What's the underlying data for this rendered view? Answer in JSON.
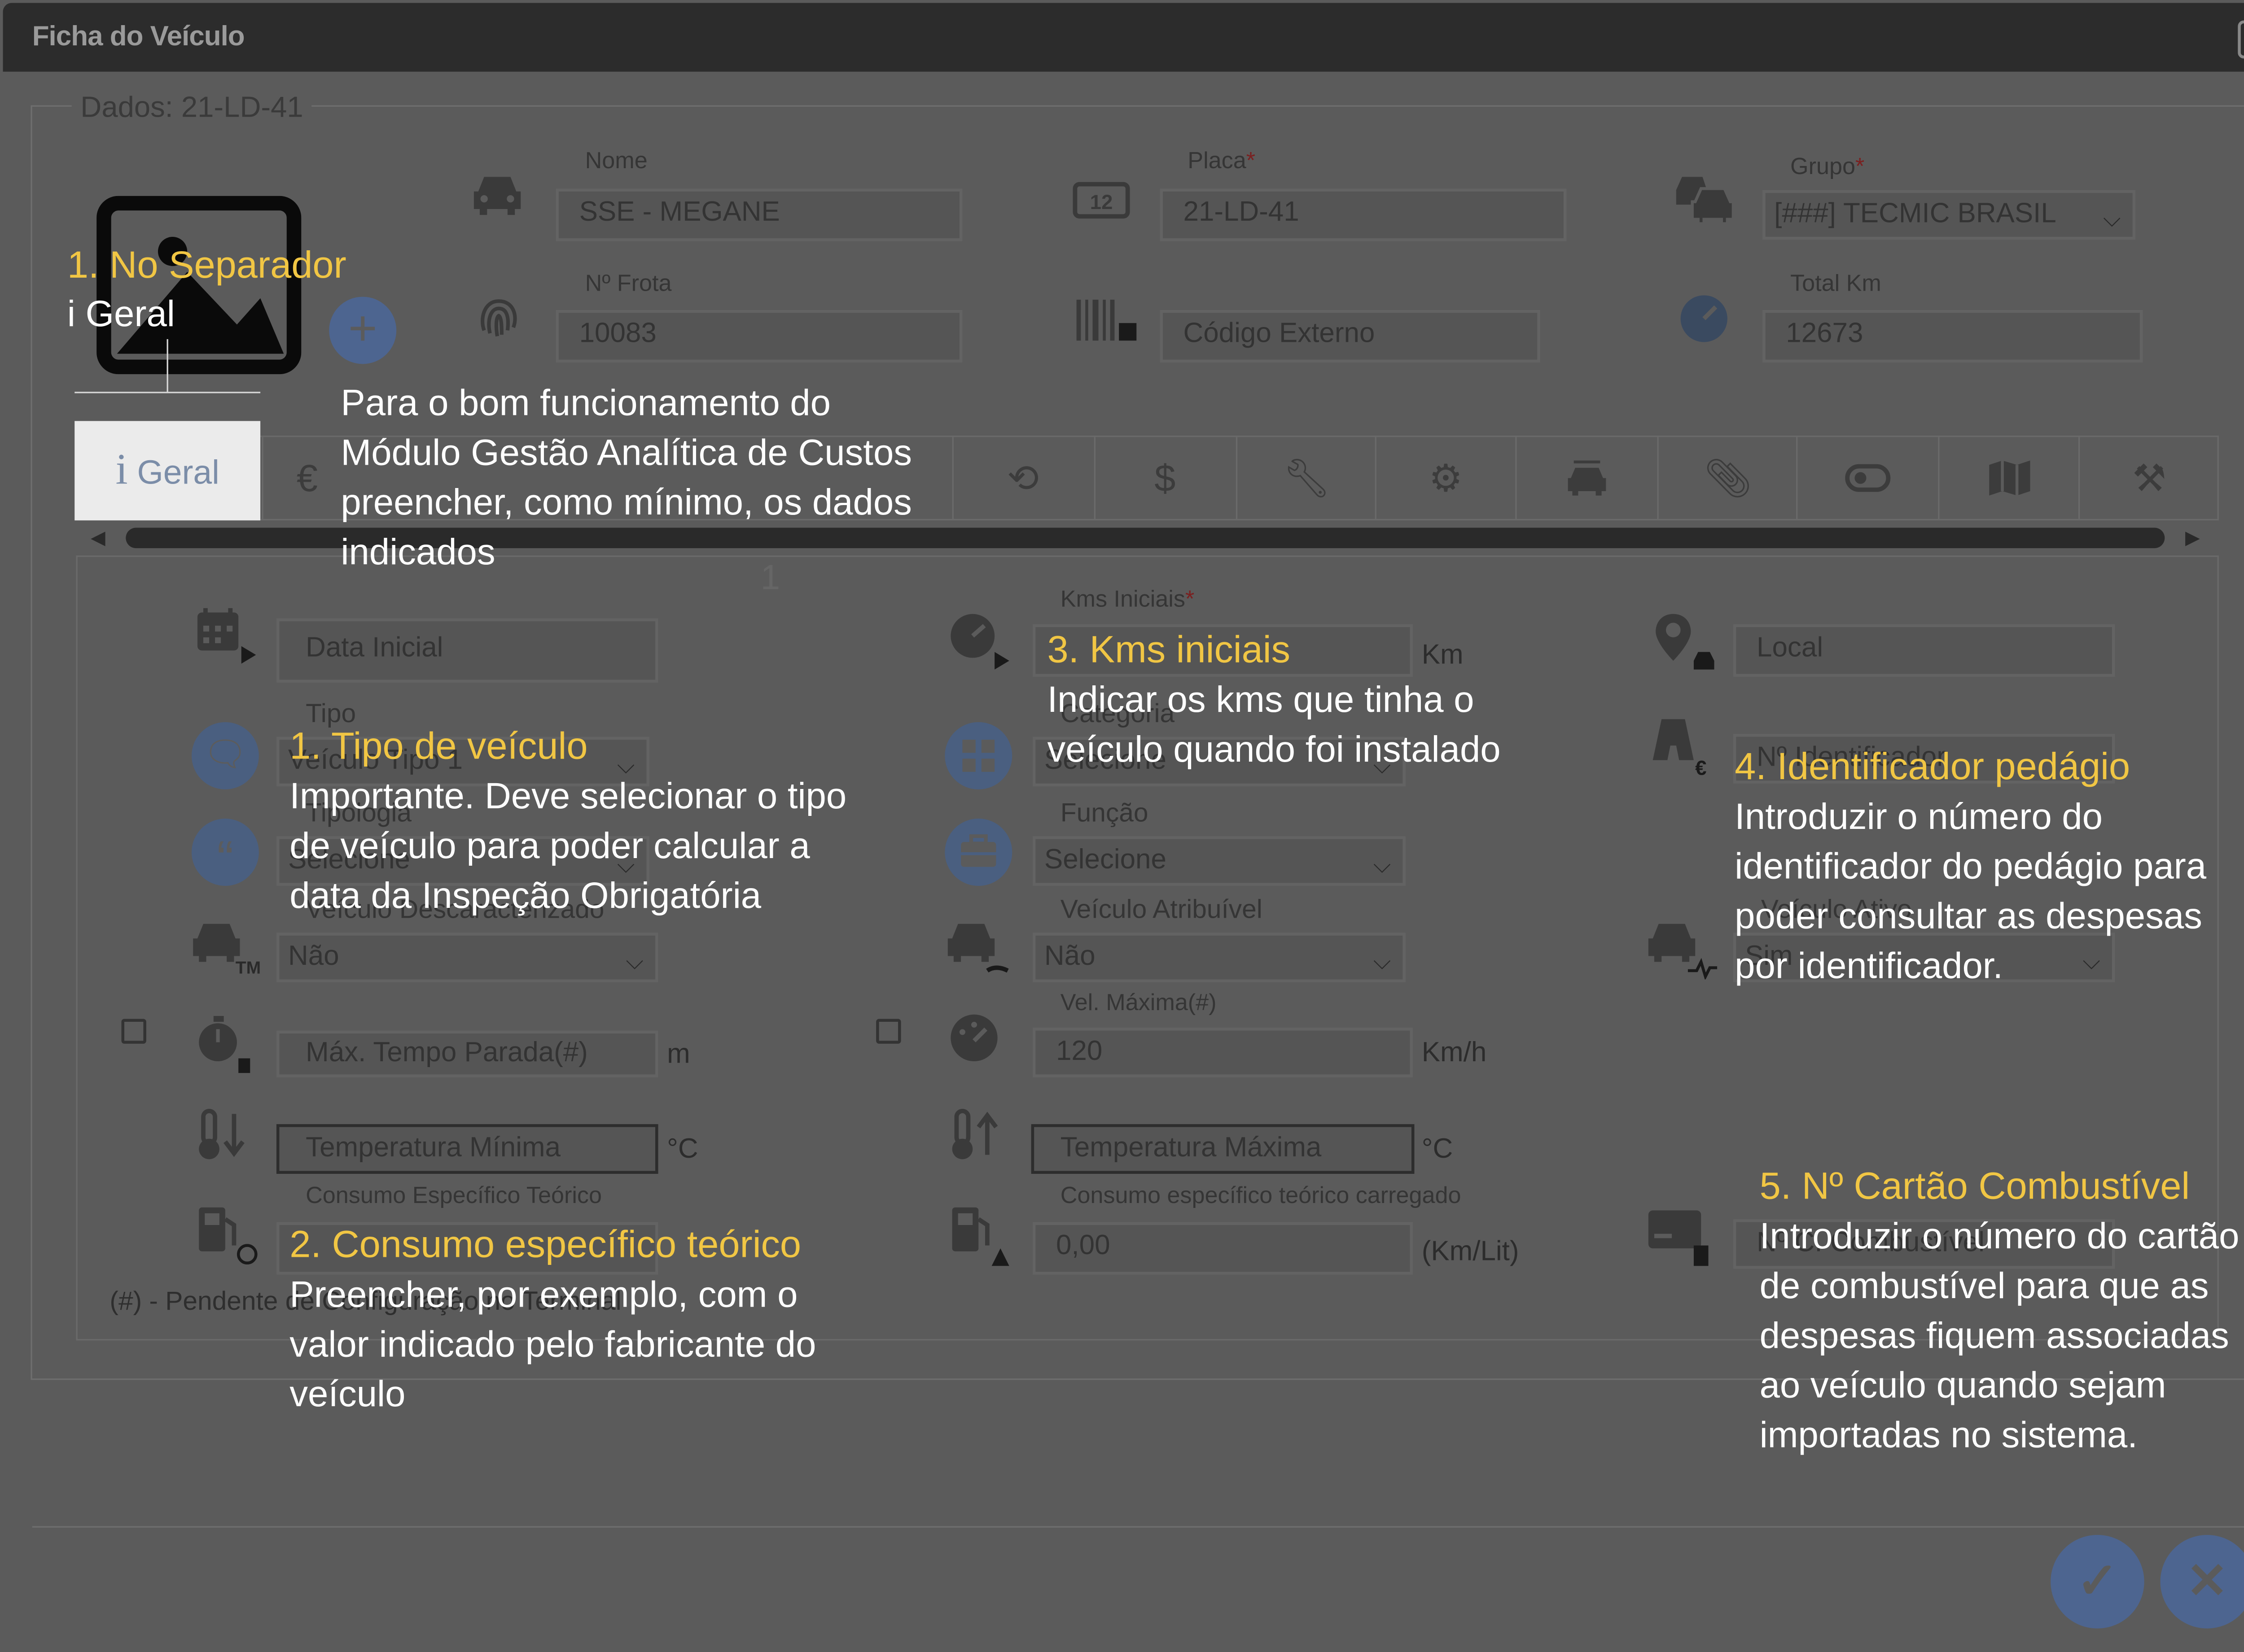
{
  "window": {
    "title": "Ficha do Veículo",
    "close_icon": "close-icon"
  },
  "section_legend": "Dados: 21-LD-41",
  "header": {
    "nome_label": "Nome",
    "nome_value": "SSE - MEGANE",
    "placa_label": "Placa",
    "placa_value": "21-LD-41",
    "grupo_label": "Grupo",
    "grupo_value": "[###] TECMIC BRASIL",
    "frota_label": "Nº Frota",
    "frota_value": "10083",
    "codigo_externo_placeholder": "Código Externo",
    "totalkm_label": "Total Km",
    "totalkm_value": "12673",
    "required_mark": "*"
  },
  "tabs": {
    "geral_icon": "i",
    "geral_label": "Geral",
    "page_indicator": "1",
    "icons": [
      "euro-icon",
      "history-icon",
      "dollar-icon",
      "wrench-icon",
      "gear-icon",
      "car-service-icon",
      "paperclip-icon",
      "toggle-icon",
      "map-icon",
      "tools-icon"
    ]
  },
  "form": {
    "data_inicial_placeholder": "Data Inicial",
    "tipo_label": "Tipo",
    "tipo_value": "Veículo Tipo 1",
    "tipologia_label": "Tipologia",
    "tipologia_value": "Selecione",
    "descaracterizado_label": "Veículo Descaracterizado",
    "descaracterizado_value": "Não",
    "max_tempo_placeholder": "Máx. Tempo Parada(#)",
    "max_tempo_unit": "m",
    "temp_min_placeholder": "Temperatura Mínima",
    "temp_unit": "°C",
    "consumo_teorico_label": "Consumo Específico Teórico",
    "kms_iniciais_label": "Kms Iniciais",
    "kms_unit": "Km",
    "categoria_label": "Categoria",
    "categoria_value": "Selecione",
    "funcao_label": "Função",
    "funcao_value": "Selecione",
    "atribuivel_label": "Veículo Atribuível",
    "atribuivel_value": "Não",
    "vel_max_label": "Vel. Máxima(#)",
    "vel_max_value": "120",
    "vel_unit": "Km/h",
    "temp_max_placeholder": "Temperatura Máxima",
    "consumo_carregado_label": "Consumo específico teórico carregado",
    "consumo_carregado_value": "0,00",
    "consumo_unit": "(Km/Lit)",
    "local_placeholder": "Local",
    "identificador_placeholder": "Nº Identificador",
    "veiculo_ativo_label": "Veículo Ativo",
    "veiculo_ativo_value": "Sim",
    "cartao_placeholder": "Nº C. Combustível",
    "pending_note": "(#) - Pendente de Configuração no Terminal"
  },
  "annotations": {
    "a0_title": "1. No Separador",
    "a0_text": "i Geral",
    "intro_line1": "Para o bom funcionamento do",
    "intro_line2": "Módulo Gestão Analítica de Custos",
    "intro_line3": "preencher, como mínimo, os dados",
    "intro_line4": "indicados",
    "a1_title": "1. Tipo de veículo",
    "a1_line1": "Importante. Deve selecionar o tipo",
    "a1_line2": "de veículo para poder calcular a",
    "a1_line3": "data da Inspeção Obrigatória",
    "a2_title": "2. Consumo específico teórico",
    "a2_line1": "Preencher, por exemplo, com o",
    "a2_line2": "valor indicado pelo fabricante do",
    "a2_line3": "veículo",
    "a3_title": "3. Kms iniciais",
    "a3_line1": "Indicar os kms que tinha o",
    "a3_line2": "veículo quando foi instalado",
    "a4_title": "4. Identificador pedágio",
    "a4_line1": "Introduzir o número do",
    "a4_line2": "identificador do pedágio para",
    "a4_line3": "poder consultar as despesas",
    "a4_line4": "por identificador.",
    "a5_title": "5. Nº Cartão Combustível",
    "a5_line1": "Introduzir o número do cartão",
    "a5_line2": "de combustível para que as",
    "a5_line3": "despesas fiquem associadas",
    "a5_line4": "ao veículo quando sejam",
    "a5_line5": "importadas no sistema."
  },
  "footer": {
    "confirm_icon": "check-icon",
    "cancel_icon": "close-icon"
  },
  "colors": {
    "annotation_title": "#f1c644",
    "annotation_text": "#ffffff",
    "accent_button": "#4d6590",
    "active_tab_bg": "#ebebeb"
  }
}
